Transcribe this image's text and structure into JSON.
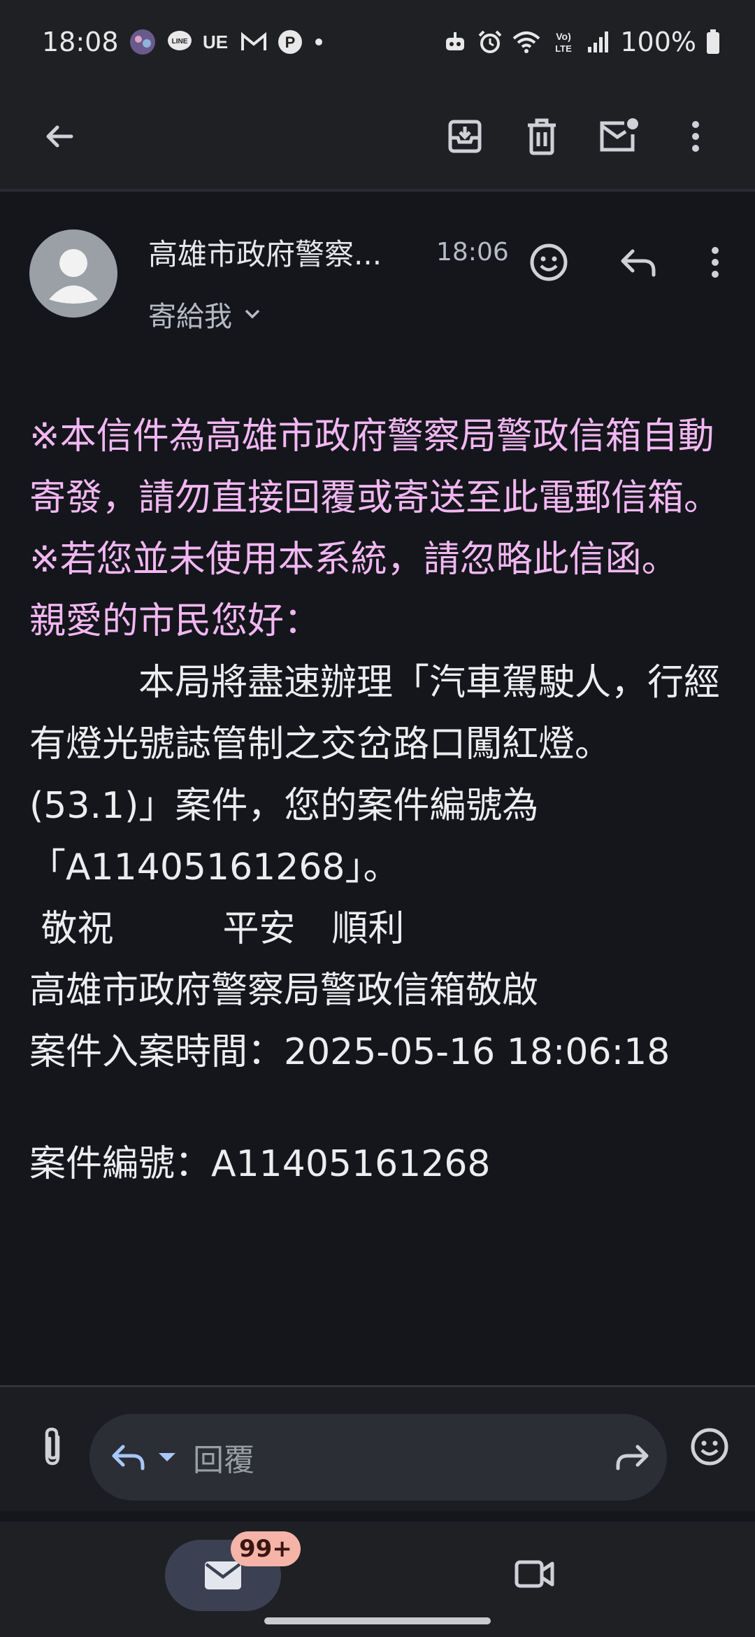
{
  "status_bar": {
    "time": "18:08",
    "icons_left": [
      "gallery-icon",
      "line-icon",
      "uber-eats-icon",
      "gmail-icon",
      "parking-icon",
      "dot"
    ],
    "icons_right": [
      "robot-icon",
      "alarm-icon",
      "wifi-icon",
      "volte-icon",
      "signal-icon"
    ],
    "battery": "100%"
  },
  "toolbar": {
    "icons": [
      "back-arrow-icon",
      "archive-icon",
      "trash-icon",
      "mark-unread-icon",
      "more-vert-icon"
    ]
  },
  "email": {
    "sender": "高雄市政府警察...",
    "time": "18:06",
    "recipient": "寄給我",
    "body": {
      "notice1": "※本信件為高雄市政府警察局警政信箱自動寄發，請勿直接回覆或寄送至此電郵信箱。",
      "notice2": "※若您並未使用本系統，請忽略此信函。",
      "greeting": "親愛的市民您好：",
      "main": "　　　本局將盡速辦理「汽車駕駛人，行經有燈光號誌管制之交岔路口闖紅燈。(53.1)」案件，您的案件編號為「A11405161268」。",
      "closing": " 敬祝　　　平安　順利",
      "signature": "高雄市政府警察局警政信箱敬啟",
      "case_time": "案件入案時間：2025-05-16 18:06:18",
      "case_number": "案件編號：A11405161268"
    }
  },
  "compose": {
    "placeholder": "回覆"
  },
  "nav": {
    "mail_badge": "99+"
  },
  "colors": {
    "background": "#14161b",
    "bar": "#1f2024",
    "pink_text": "#f2b7f2",
    "badge": "#f6b4a8",
    "reply_icon": "#a8c7fa"
  }
}
